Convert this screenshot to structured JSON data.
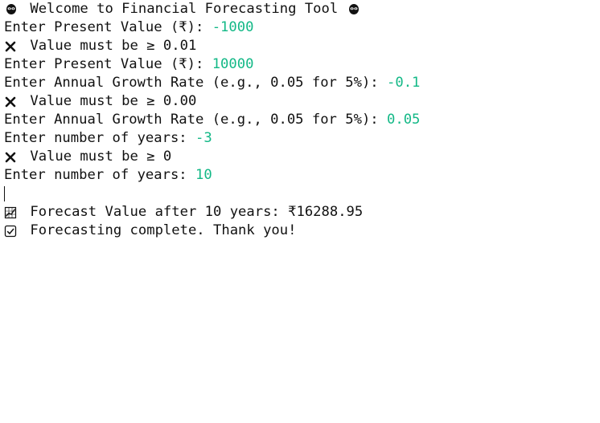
{
  "console": {
    "lines": [
      {
        "icon": "alien-icon",
        "text": " Welcome to Financial Forecasting Tool ",
        "icon_after": "alien-icon"
      },
      {
        "prompt": "Enter Present Value (₹): ",
        "input": "-1000"
      },
      {
        "icon": "cross-mark-icon",
        "text": " Value must be ≥ 0.01"
      },
      {
        "prompt": "Enter Present Value (₹): ",
        "input": "10000"
      },
      {
        "prompt": "Enter Annual Growth Rate (e.g., 0.05 for 5%): ",
        "input": "-0.1"
      },
      {
        "icon": "cross-mark-icon",
        "text": " Value must be ≥ 0.00"
      },
      {
        "prompt": "Enter Annual Growth Rate (e.g., 0.05 for 5%): ",
        "input": "0.05"
      },
      {
        "prompt": "Enter number of years: ",
        "input": "-3"
      },
      {
        "icon": "cross-mark-icon",
        "text": " Value must be ≥ 0"
      },
      {
        "prompt": "Enter number of years: ",
        "input": "10"
      },
      {
        "icon": "chart-increasing-icon",
        "text": " Forecast Value after 10 years: ₹16288.95"
      },
      {
        "icon": "check-box-icon",
        "text": " Forecasting complete. Thank you!"
      }
    ]
  },
  "colors": {
    "input": "#12b886",
    "text": "#111111",
    "background": "#ffffff"
  }
}
